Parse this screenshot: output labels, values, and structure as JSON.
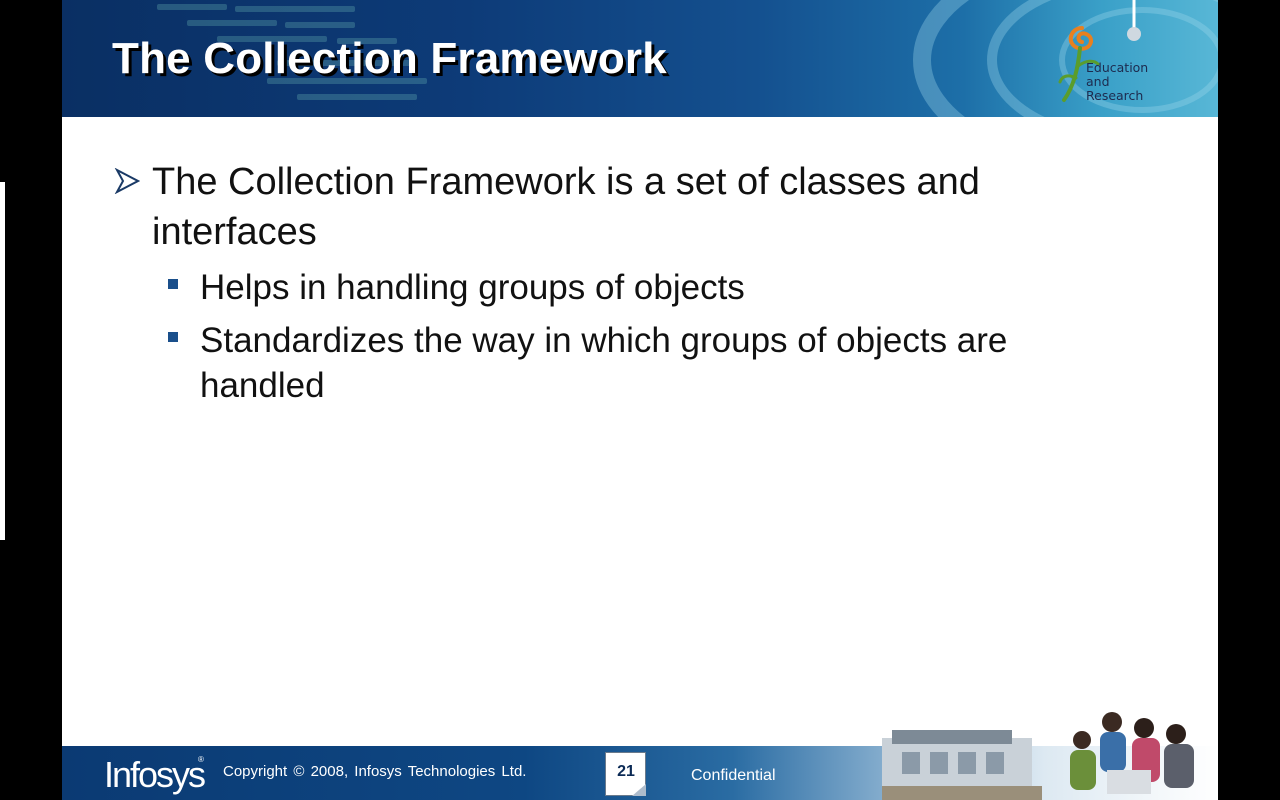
{
  "slide": {
    "title": "The Collection Framework",
    "logo": {
      "lines": "Education\nand\nResearch"
    },
    "bullets": [
      {
        "text": "The Collection Framework is a set of classes and interfaces",
        "sub": [
          "Helps in handling groups of objects",
          "Standardizes the way in which groups of objects are handled"
        ]
      }
    ]
  },
  "footer": {
    "brand": "Infosys",
    "registered": "®",
    "copyright": "Copyright © 2008, Infosys Technologies Ltd.",
    "page_number": "21",
    "confidential": "Confidential"
  },
  "icons": {
    "bullet_level1": "arrowhead-bullet-icon",
    "bullet_level2": "square-bullet-icon",
    "logo": "education-research-flower-logo"
  },
  "colors": {
    "header_dark": "#0a2f63",
    "header_light": "#58b7d6",
    "bullet_blue": "#1a4f8b",
    "logo_orange": "#e8801f",
    "logo_green": "#5a9d2c"
  }
}
